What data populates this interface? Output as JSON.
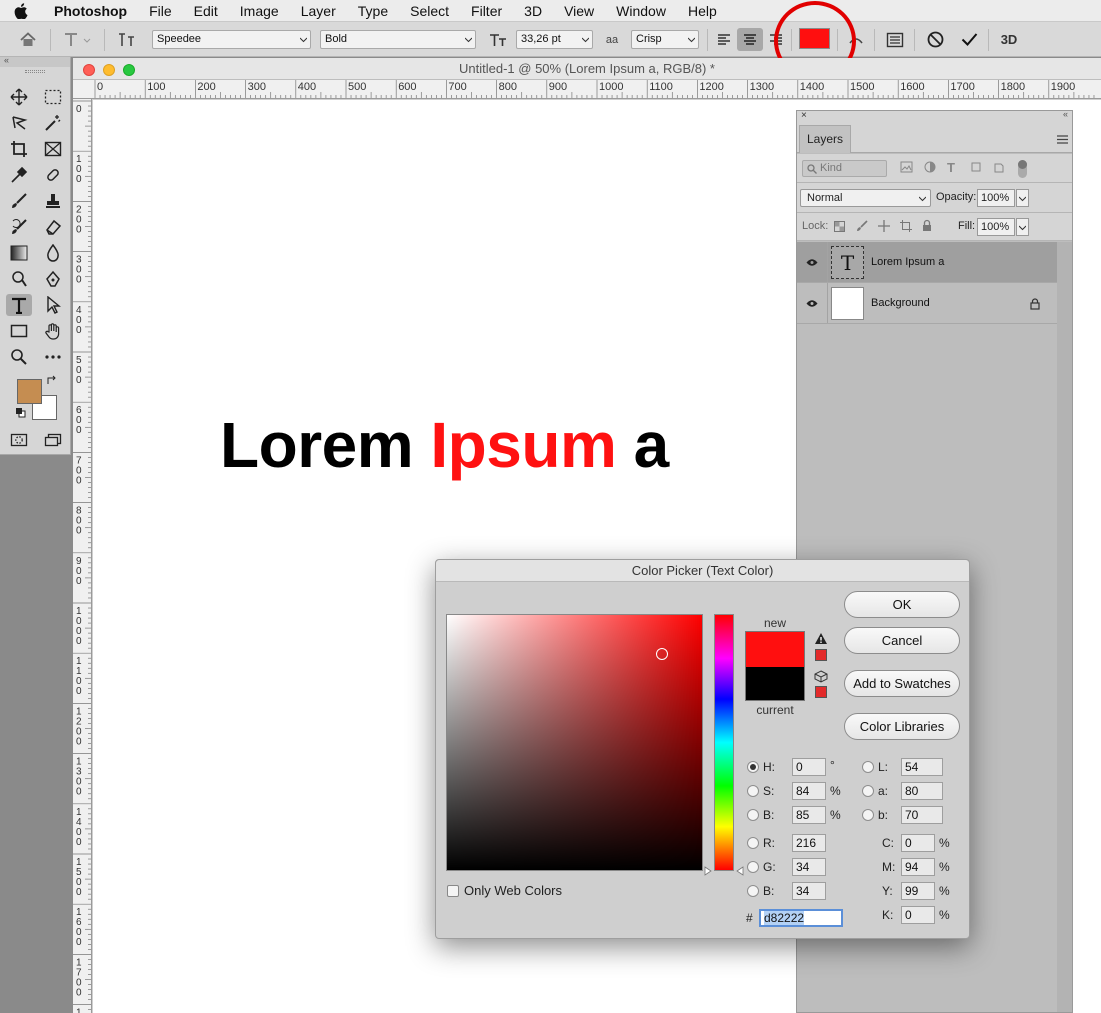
{
  "menubar": {
    "apple_icon": "apple-icon",
    "items": [
      "Photoshop",
      "File",
      "Edit",
      "Image",
      "Layer",
      "Type",
      "Select",
      "Filter",
      "3D",
      "View",
      "Window",
      "Help"
    ]
  },
  "options_bar": {
    "font_family": "Speedee",
    "font_style": "Bold",
    "font_size": "33,26 pt",
    "antialias_icon": "aa",
    "antialias": "Crisp",
    "text_color": "#ff0f0f",
    "commit_3d_label": "3D"
  },
  "document": {
    "title": "Untitled-1 @ 50% (Lorem Ipsum a, RGB/8) *",
    "ruler_top": [
      "0",
      "100",
      "200",
      "300",
      "400",
      "500",
      "600",
      "700",
      "800",
      "900",
      "1000",
      "1100",
      "1200",
      "1300",
      "1400",
      "1500",
      "1600",
      "1700",
      "1800",
      "1900"
    ],
    "ruler_left": [
      "0",
      "100",
      "200",
      "300",
      "400",
      "500",
      "600",
      "700",
      "800",
      "900",
      "1000",
      "1100",
      "1200",
      "1300",
      "1400",
      "1500",
      "1600",
      "1700",
      "1800"
    ],
    "text_black_1": "Lorem ",
    "text_red": "Ipsum",
    "text_black_2": " a"
  },
  "tools": {
    "foreground_color": "#c58d51",
    "background_color": "#ffffff"
  },
  "layers_panel": {
    "tab": "Layers",
    "filter_kind": "Kind",
    "blend_mode": "Normal",
    "opacity_label": "Opacity:",
    "opacity": "100%",
    "lock_label": "Lock:",
    "fill_label": "Fill:",
    "fill": "100%",
    "layers": [
      {
        "name": "Lorem Ipsum a",
        "type_icon": "T"
      },
      {
        "name": "Background"
      }
    ]
  },
  "color_picker": {
    "title": "Color Picker (Text Color)",
    "new_label": "new",
    "current_label": "current",
    "new_color": "#ff0f0f",
    "current_color": "#000000",
    "buttons": {
      "ok": "OK",
      "cancel": "Cancel",
      "add_to_swatches": "Add to Swatches",
      "color_libraries": "Color Libraries"
    },
    "only_web_colors": "Only Web Colors",
    "hsb": {
      "h_label": "H:",
      "h": "0",
      "h_unit": "°",
      "s_label": "S:",
      "s": "84",
      "s_unit": "%",
      "b_label": "B:",
      "b": "85",
      "b_unit": "%"
    },
    "rgb": {
      "r_label": "R:",
      "r": "216",
      "g_label": "G:",
      "g": "34",
      "b_label": "B:",
      "b": "34"
    },
    "lab": {
      "l_label": "L:",
      "l": "54",
      "a_label": "a:",
      "a": "80",
      "b_label": "b:",
      "b": "70"
    },
    "cmyk": {
      "c_label": "C:",
      "c": "0",
      "m_label": "M:",
      "m": "94",
      "y_label": "Y:",
      "y": "99",
      "k_label": "K:",
      "k": "0",
      "unit": "%"
    },
    "hex_label": "#",
    "hex": "d82222"
  }
}
